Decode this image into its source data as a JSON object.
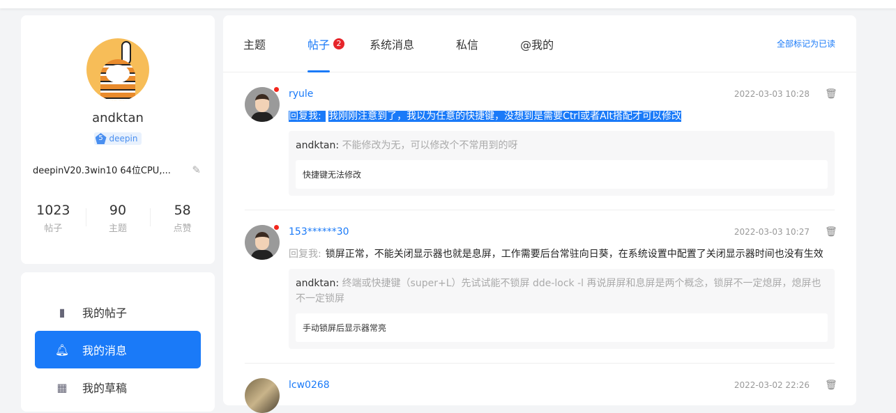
{
  "profile": {
    "username": "andktan",
    "level": "5",
    "group": "deepin",
    "signature": "deepinV20.3win10 64位CPU,...",
    "stats": [
      {
        "value": "1023",
        "label": "帖子"
      },
      {
        "value": "90",
        "label": "主题"
      },
      {
        "value": "58",
        "label": "点赞"
      }
    ]
  },
  "nav": [
    {
      "label": "我的帖子",
      "icon": "bookmark-icon"
    },
    {
      "label": "我的消息",
      "icon": "bell-icon"
    },
    {
      "label": "我的草稿",
      "icon": "archive-icon"
    }
  ],
  "tabs": [
    {
      "label": "主题"
    },
    {
      "label": "帖子",
      "count": "2"
    },
    {
      "label": "系统消息"
    },
    {
      "label": "私信"
    },
    {
      "label": "@我的"
    }
  ],
  "mark_all_read": "全部标记为已读",
  "messages": [
    {
      "user": "ryule",
      "time": "2022-03-03 10:28",
      "reply_prefix": "回复我:",
      "reply": "我刚刚注意到了，我以为任意的快捷键，没想到是需要Ctrl或者Alt搭配才可以修改",
      "quote_user": "andktan:",
      "quote": "不能修改为无，可以修改个不常用到的呀",
      "topic": "快捷键无法修改",
      "unread": true
    },
    {
      "user": "153******30",
      "time": "2022-03-03 10:27",
      "reply_prefix": "回复我:",
      "reply": "锁屏正常，不能关闭显示器也就是息屏，工作需要后台常驻向日葵，在系统设置中配置了关闭显示器时间也没有生效",
      "quote_user": "andktan:",
      "quote": "终端或快捷键（super+L）先试试能不锁屏 dde-lock -l 再说屏屏和息屏是两个概念，锁屏不一定熄屏，熄屏也不一定锁屏",
      "topic": "手动锁屏后显示器常亮",
      "unread": true
    },
    {
      "user": "lcw0268",
      "time": "2022-03-02 22:26"
    }
  ]
}
